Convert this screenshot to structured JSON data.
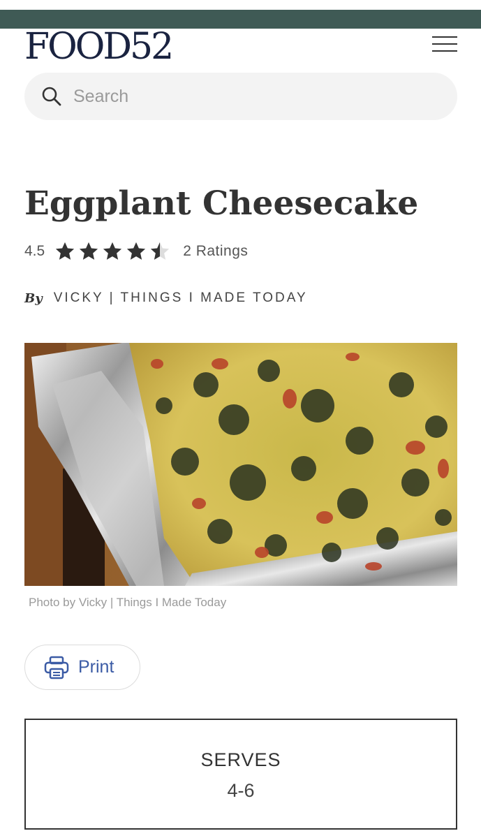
{
  "brand": {
    "logo_text": "FOOD52",
    "bar_color": "#3f5a55"
  },
  "search": {
    "placeholder": "Search"
  },
  "recipe": {
    "title": "Eggplant Cheesecake",
    "rating_value": "4.5",
    "rating_stars": 4.5,
    "rating_count": "2 Ratings",
    "by_label": "By",
    "author": "VICKY | THINGS I MADE TODAY",
    "photo_caption": "Photo by Vicky | Things I Made Today"
  },
  "actions": {
    "print_label": "Print",
    "print_color": "#3b5ba5"
  },
  "serves": {
    "label": "SERVES",
    "value": "4-6"
  },
  "icons": {
    "menu": "hamburger-menu-icon",
    "search": "search-icon",
    "star": "star-icon",
    "print": "printer-icon"
  }
}
